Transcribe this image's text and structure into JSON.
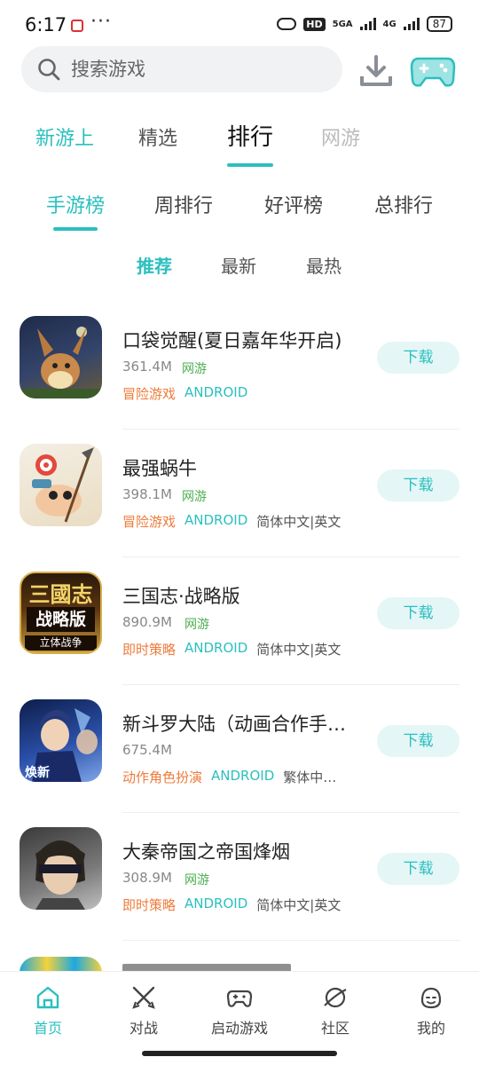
{
  "status_bar": {
    "time": "6:17",
    "dots": "···",
    "hd": "HD",
    "net1": "5GA",
    "net2": "4G",
    "battery": "87"
  },
  "search": {
    "placeholder": "搜索游戏"
  },
  "main_tabs": [
    {
      "label": "新游上"
    },
    {
      "label": "精选"
    },
    {
      "label": "排行"
    },
    {
      "label": "网游"
    }
  ],
  "rank_tabs": [
    {
      "label": "手游榜"
    },
    {
      "label": "周排行"
    },
    {
      "label": "好评榜"
    },
    {
      "label": "总排行"
    }
  ],
  "filters": [
    {
      "label": "推荐"
    },
    {
      "label": "最新"
    },
    {
      "label": "最热"
    }
  ],
  "games": [
    {
      "name": "口袋觉醒(夏日嘉年华开启)",
      "size": "361.4M",
      "net": "网游",
      "genre": "冒险游戏",
      "platform": "ANDROID",
      "lang": "",
      "button": "下载"
    },
    {
      "name": "最强蜗牛",
      "size": "398.1M",
      "net": "网游",
      "genre": "冒险游戏",
      "platform": "ANDROID",
      "lang": "简体中文|英文",
      "button": "下载"
    },
    {
      "name": "三国志·战略版",
      "size": "890.9M",
      "net": "网游",
      "genre": "即时策略",
      "platform": "ANDROID",
      "lang": "简体中文|英文",
      "button": "下载"
    },
    {
      "name": "新斗罗大陆（动画合作手…",
      "size": "675.4M",
      "net": "",
      "genre": "动作角色扮演",
      "platform": "ANDROID",
      "lang": "繁体中…",
      "button": "下载"
    },
    {
      "name": "大秦帝国之帝国烽烟",
      "size": "308.9M",
      "net": "网游",
      "genre": "即时策略",
      "platform": "ANDROID",
      "lang": "简体中文|英文",
      "button": "下载"
    }
  ],
  "thumb_text": {
    "sanguo_top": "三國志",
    "sanguo_mid": "战略版",
    "sanguo_bottom": "立体战争",
    "douluo_badge": "焕新"
  },
  "bottom_nav": [
    {
      "label": "首页",
      "icon": "home-icon"
    },
    {
      "label": "对战",
      "icon": "swords-icon"
    },
    {
      "label": "启动游戏",
      "icon": "gamepad-icon"
    },
    {
      "label": "社区",
      "icon": "planet-icon"
    },
    {
      "label": "我的",
      "icon": "smiley-icon"
    }
  ],
  "colors": {
    "accent": "#2bbfbf",
    "genre": "#ee7b3a",
    "net": "#4caf50",
    "button_bg": "#e4f6f6"
  }
}
